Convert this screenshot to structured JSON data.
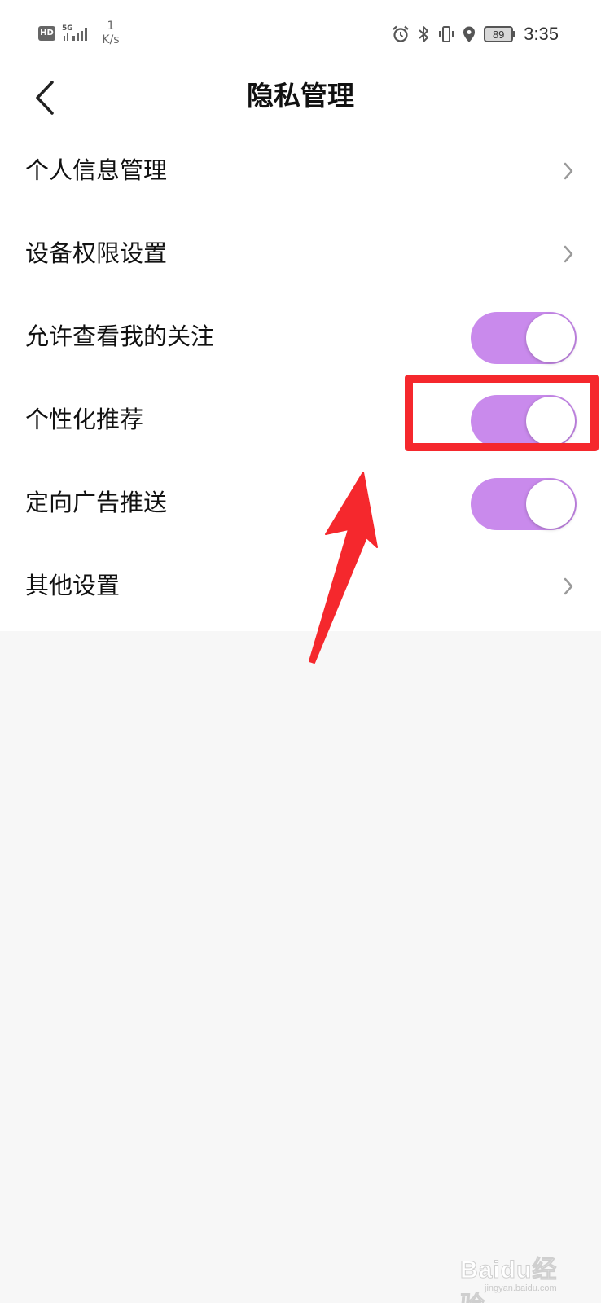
{
  "status_bar": {
    "hd": "HD",
    "network": "5G",
    "speed_value": "1",
    "speed_unit": "K/s",
    "battery": "89",
    "time": "3:35",
    "icons": [
      "alarm-icon",
      "bluetooth-icon",
      "vibrate-icon",
      "location-icon"
    ]
  },
  "header": {
    "title": "隐私管理",
    "back_icon": "chevron-left-icon"
  },
  "settings": {
    "items": [
      {
        "label": "个人信息管理",
        "control": "chevron"
      },
      {
        "label": "设备权限设置",
        "control": "chevron"
      },
      {
        "label": "允许查看我的关注",
        "control": "toggle",
        "on": true
      },
      {
        "label": "个性化推荐",
        "control": "toggle",
        "on": true
      },
      {
        "label": "定向广告推送",
        "control": "toggle",
        "on": true
      },
      {
        "label": "其他设置",
        "control": "chevron"
      }
    ]
  },
  "colors": {
    "toggle_on": "#c98aec",
    "annotation_red": "#f5282d",
    "background": "#f7f7f7",
    "surface": "#ffffff"
  },
  "watermark": {
    "brand": "Baidu经验",
    "site": "jingyan.baidu.com"
  }
}
